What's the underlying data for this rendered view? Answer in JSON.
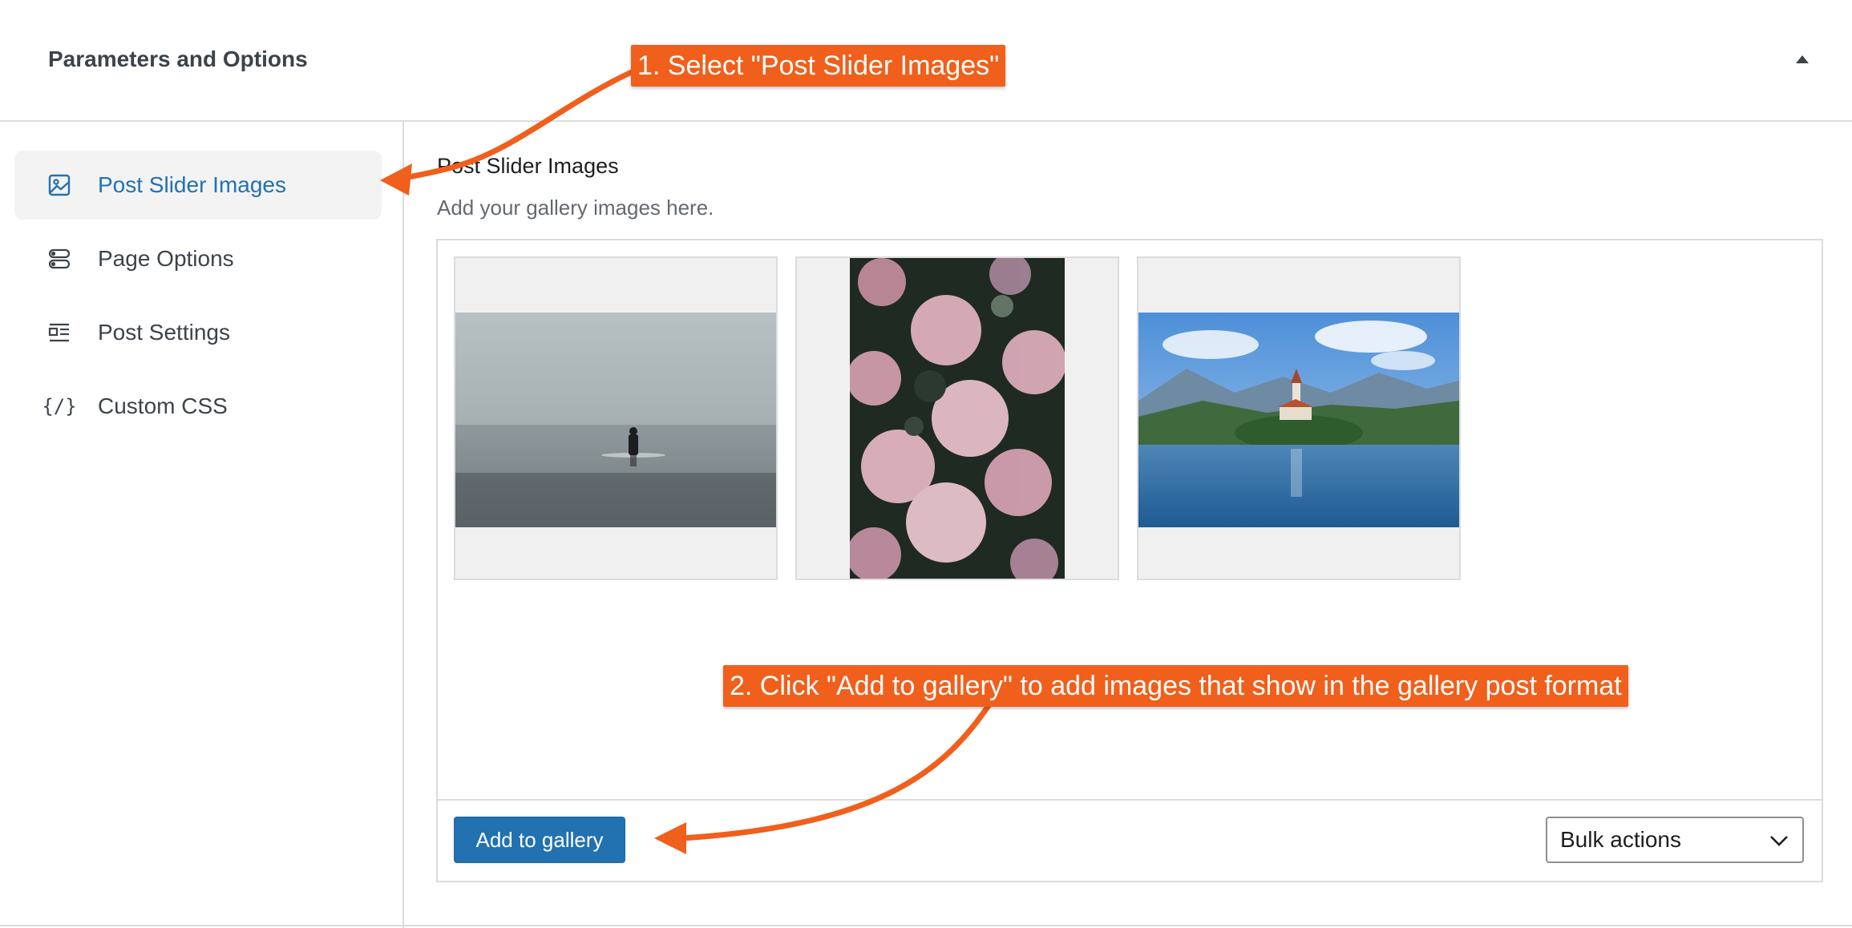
{
  "header": {
    "title": "Parameters and Options"
  },
  "sidebar": {
    "items": [
      {
        "label": "Post Slider Images",
        "icon": "image-icon",
        "active": true
      },
      {
        "label": "Page Options",
        "icon": "toggle-options-icon",
        "active": false
      },
      {
        "label": "Post Settings",
        "icon": "post-settings-icon",
        "active": false
      },
      {
        "label": "Custom CSS",
        "icon": "code-braces-icon",
        "css_glyph": "{/}",
        "active": false
      }
    ]
  },
  "field": {
    "label": "Post Slider Images",
    "description": "Add your gallery images here."
  },
  "gallery": {
    "images": [
      {
        "name": "person-in-sea-image"
      },
      {
        "name": "pink-flowers-image"
      },
      {
        "name": "lake-island-church-image"
      }
    ],
    "add_button_label": "Add to gallery",
    "bulk_select_value": "Bulk actions"
  },
  "annotations": {
    "step1": "1. Select \"Post Slider Images\"",
    "step2": "2. Click \"Add to gallery\" to add images that show in the gallery post format"
  },
  "colors": {
    "accent": "#2271b1",
    "callout": "#f05f1b",
    "border": "#dcdcde"
  }
}
